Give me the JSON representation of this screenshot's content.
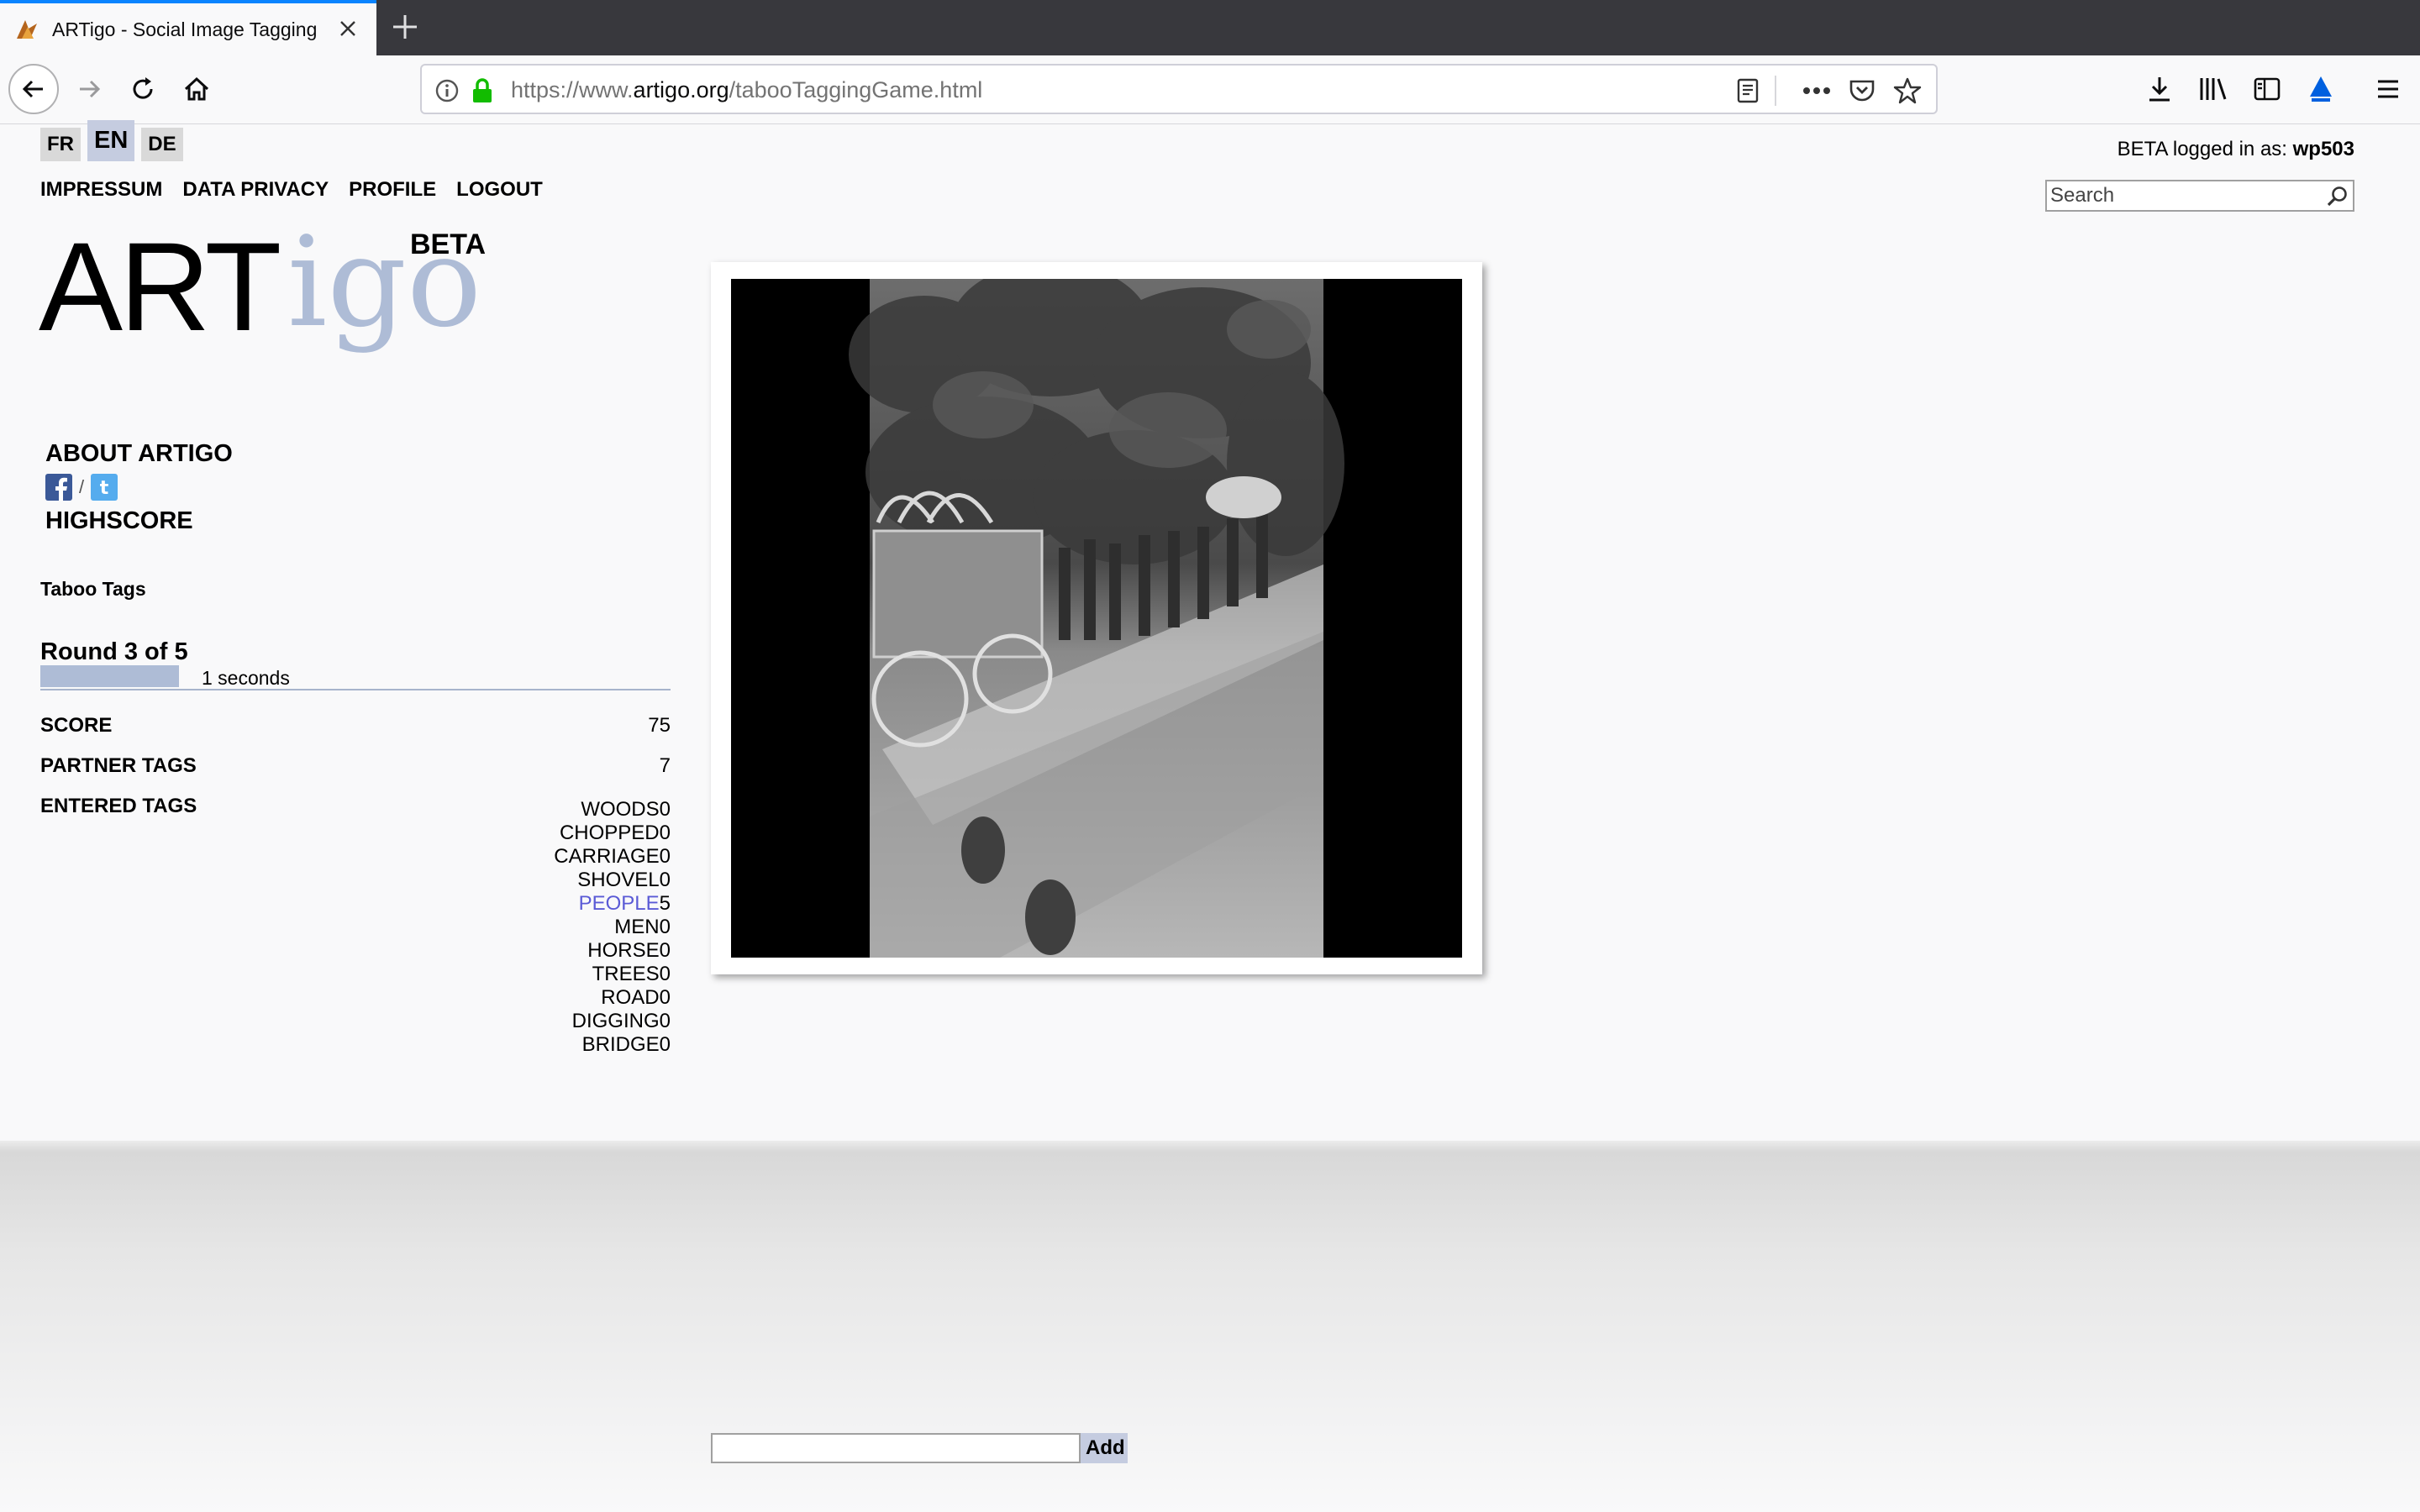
{
  "browser": {
    "tab_title": "ARTigo - Social Image Tagging",
    "url_prefix": "https://www.",
    "url_host": "artigo.org",
    "url_path": "/tabooTaggingGame.html"
  },
  "languages": [
    {
      "code": "FR",
      "active": false
    },
    {
      "code": "EN",
      "active": true
    },
    {
      "code": "DE",
      "active": false
    }
  ],
  "nav": {
    "impressum": "IMPRESSUM",
    "privacy": "DATA PRIVACY",
    "profile": "PROFILE",
    "logout": "LOGOUT"
  },
  "logo": {
    "art": "ART",
    "igo": "igo",
    "beta": "BETA"
  },
  "sidebar": {
    "about": "ABOUT ARTIGO",
    "social_separator": "/",
    "highscore": "HIGHSCORE",
    "game_title": "Taboo Tags"
  },
  "round": {
    "label": "Round 3 of 5",
    "timer_text": "1 seconds",
    "timer_fraction": 0.22
  },
  "stats": {
    "score_label": "SCORE",
    "score_value": "75",
    "partner_label": "PARTNER TAGS",
    "partner_value": "7",
    "entered_label": "ENTERED TAGS"
  },
  "entered_tags": [
    {
      "name": "WOODS",
      "count": "0",
      "highlight": false
    },
    {
      "name": "CHOPPED",
      "count": "0",
      "highlight": false
    },
    {
      "name": "CARRIAGE",
      "count": "0",
      "highlight": false
    },
    {
      "name": "SHOVEL",
      "count": "0",
      "highlight": false
    },
    {
      "name": "PEOPLE",
      "count": "5",
      "highlight": true
    },
    {
      "name": "MEN",
      "count": "0",
      "highlight": false
    },
    {
      "name": "HORSE",
      "count": "0",
      "highlight": false
    },
    {
      "name": "TREES",
      "count": "0",
      "highlight": false
    },
    {
      "name": "ROAD",
      "count": "0",
      "highlight": false
    },
    {
      "name": "DIGGING",
      "count": "0",
      "highlight": false
    },
    {
      "name": "BRIDGE",
      "count": "0",
      "highlight": false
    }
  ],
  "user": {
    "prefix": "BETA logged in as: ",
    "name": "wp503"
  },
  "search": {
    "placeholder": "Search"
  },
  "tag_entry": {
    "value": "",
    "add_label": "Add"
  },
  "colors": {
    "accent": "#aebcd6",
    "highlight_tag": "#5a5ad6",
    "tab_indicator": "#0a84ff"
  }
}
